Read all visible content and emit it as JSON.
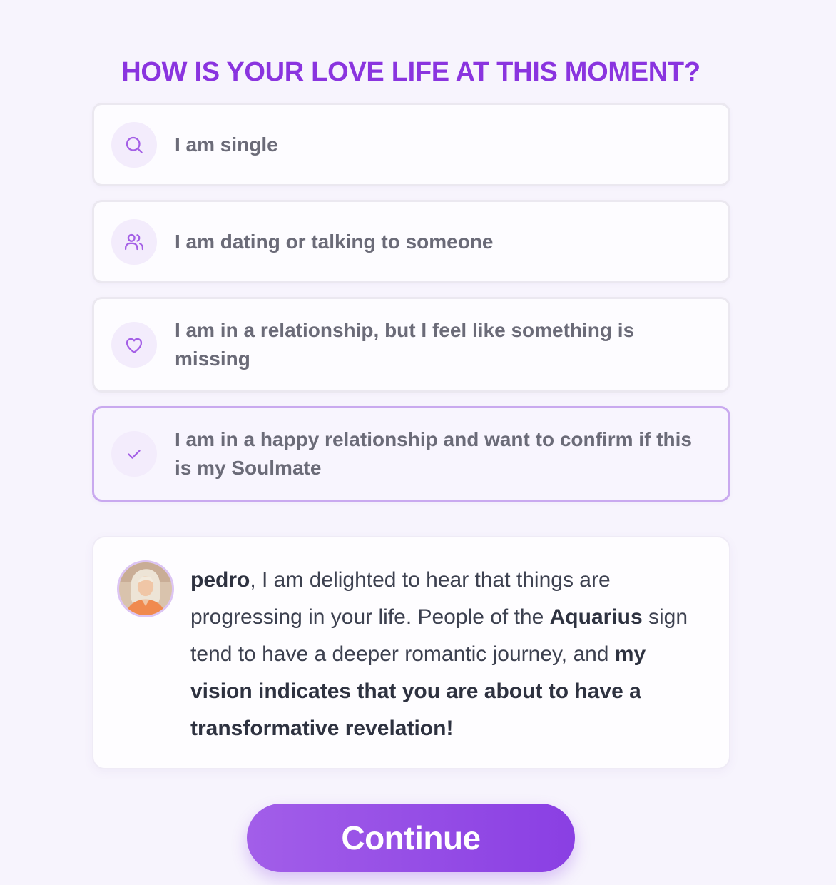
{
  "question": {
    "title": "HOW IS YOUR LOVE LIFE AT THIS MOMENT?"
  },
  "options": [
    {
      "label": "I am single",
      "icon": "search-icon",
      "selected": false
    },
    {
      "label": "I am dating or talking to someone",
      "icon": "users-icon",
      "selected": false
    },
    {
      "label": "I am in a relationship, but I feel like something is missing",
      "icon": "heart-icon",
      "selected": false
    },
    {
      "label": "I am in a happy relationship and want to confirm if this is my Soulmate",
      "icon": "check-icon",
      "selected": true
    }
  ],
  "message": {
    "name": "pedro",
    "part1": ", I am delighted to hear that things are progressing in your life. People of the ",
    "sign": "Aquarius",
    "part2": " sign tend to have a deeper romantic journey, and ",
    "highlight": "my vision indicates that you are about to have a transformative revelation!"
  },
  "continue_label": "Continue",
  "colors": {
    "accent": "#8a34df",
    "icon_stroke": "#a45fe6",
    "selected_border": "#c9a9ef",
    "background": "#f7f4fd"
  }
}
